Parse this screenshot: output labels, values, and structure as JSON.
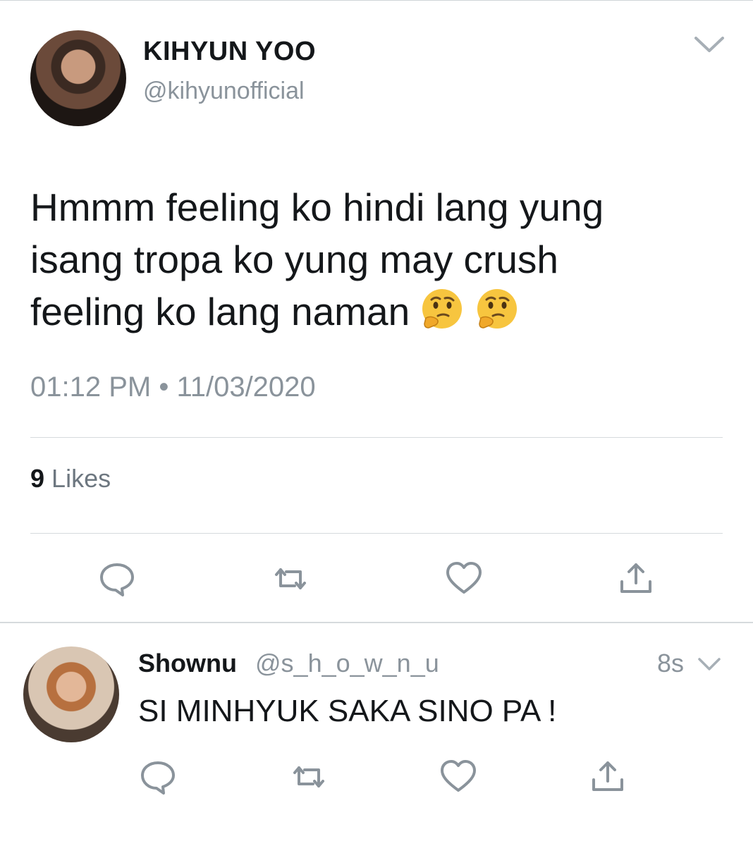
{
  "tweet": {
    "display_name": "KIHYUN YOO",
    "handle": "@kihyunofficial",
    "text_lines": [
      "Hmmm feeling ko hindi lang yung",
      "isang tropa ko yung may crush",
      "feeling ko lang naman"
    ],
    "emojis": [
      "thinking-face",
      "thinking-face"
    ],
    "timestamp": "01:12 PM • 11/03/2020",
    "likes_count": "9",
    "likes_label": "Likes"
  },
  "reply": {
    "display_name": "Shownu",
    "handle": "@s_h_o_w_n_u",
    "time_ago": "8s",
    "text": "SI MINHYUK SAKA SINO PA !"
  },
  "icons": {
    "actions": [
      "reply-icon",
      "retweet-icon",
      "like-icon",
      "share-icon"
    ],
    "menu": "chevron-down-icon"
  },
  "colors": {
    "text": "#14171a",
    "secondary_text": "#8a939b",
    "icon": "#8a939b",
    "divider": "#d6dadd",
    "emoji_yellow": "#f7c53f"
  }
}
